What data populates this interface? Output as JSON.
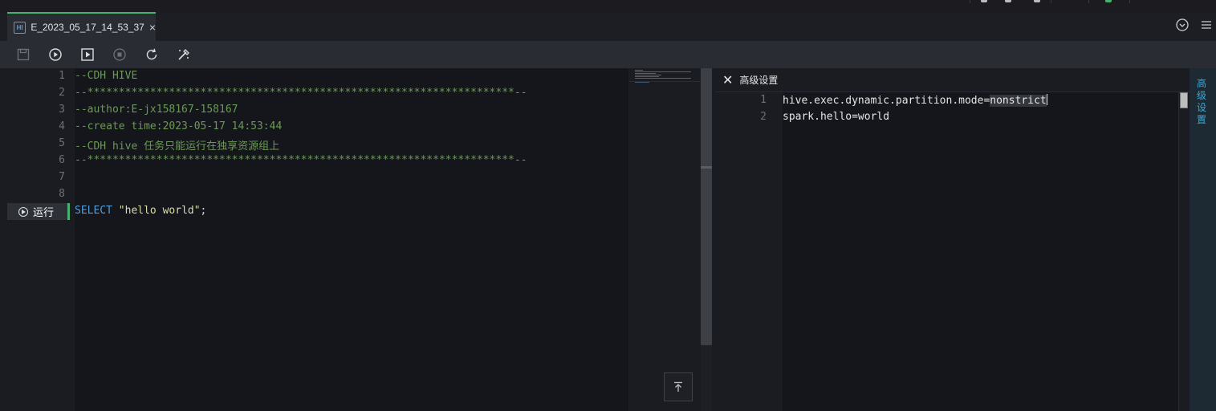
{
  "tab": {
    "icon_text": "HI",
    "title": "E_2023_05_17_14_53_37",
    "close_glyph": "×"
  },
  "tabbar_icons": [
    "chevron-circle-icon",
    "hamburger-menu-icon"
  ],
  "toolbar": {
    "buttons": [
      "save-icon",
      "run-icon",
      "run-selected-icon",
      "stop-icon",
      "refresh-icon",
      "format-icon"
    ]
  },
  "editor": {
    "line_numbers": [
      "1",
      "2",
      "3",
      "4",
      "5",
      "6",
      "7",
      "8"
    ],
    "lines": [
      "--CDH HIVE",
      "--********************************************************************--",
      "--author:E-jx158167-158167",
      "--create time:2023-05-17 14:53:44",
      "--CDH hive 任务只能运行在独享资源组上",
      "--********************************************************************--",
      "",
      ""
    ],
    "run_label": "运行",
    "sql": {
      "keyword": "SELECT",
      "string": "\"hello world\"",
      "end": ";"
    }
  },
  "advanced": {
    "close_glyph": "✕",
    "title": "高级设置",
    "line_numbers": [
      "1",
      "2"
    ],
    "line1_prefix": "hive.exec.dynamic.partition.mode=",
    "line1_value": "nonstrict",
    "line2": "spark.hello=world"
  },
  "rail": {
    "label": "高级设置"
  },
  "colors": {
    "accent_green": "#45b36b",
    "comment": "#6a9955",
    "keyword": "#569cd6",
    "string": "#dcdcaa",
    "rail_text": "#3aa9d9"
  }
}
